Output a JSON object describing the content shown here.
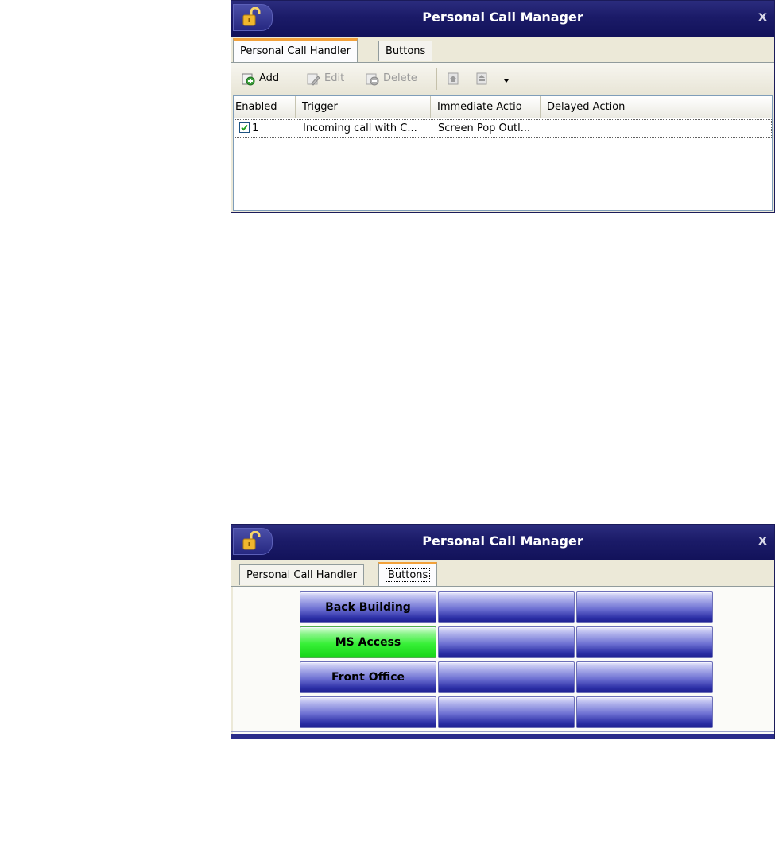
{
  "window_top": {
    "title": "Personal Call Manager",
    "close_glyph": "x",
    "tabs": [
      {
        "label": "Personal Call Handler",
        "active": true
      },
      {
        "label": "Buttons",
        "active": false
      }
    ],
    "toolbar": {
      "add_label": "Add",
      "edit_label": "Edit",
      "delete_label": "Delete",
      "icons": [
        "add-icon",
        "edit-icon",
        "delete-icon",
        "move-up-icon",
        "move-down-icon",
        "dropdown-arrow-icon"
      ]
    },
    "grid": {
      "columns": [
        "Enabled",
        "Trigger",
        "Immediate Actio",
        "Delayed Action"
      ],
      "rows": [
        {
          "enabled": true,
          "id": "1",
          "trigger": "Incoming call with C...",
          "immediate": "Screen Pop Outl...",
          "delayed": ""
        }
      ]
    }
  },
  "window_bottom": {
    "title": "Personal Call Manager",
    "close_glyph": "x",
    "tabs": [
      {
        "label": "Personal Call Handler",
        "active": false
      },
      {
        "label": "Buttons",
        "active": true
      }
    ],
    "buttons": [
      [
        "Back Building",
        "",
        ""
      ],
      [
        "MS Access",
        "",
        ""
      ],
      [
        "Front Office",
        "",
        ""
      ],
      [
        "",
        "",
        ""
      ]
    ],
    "highlighted_button": "MS Access",
    "colors": {
      "button_blue": "#2c2fa6",
      "button_green": "#37f037",
      "titlebar": "#1b1b68",
      "tab_accent": "#f2a13a"
    }
  }
}
